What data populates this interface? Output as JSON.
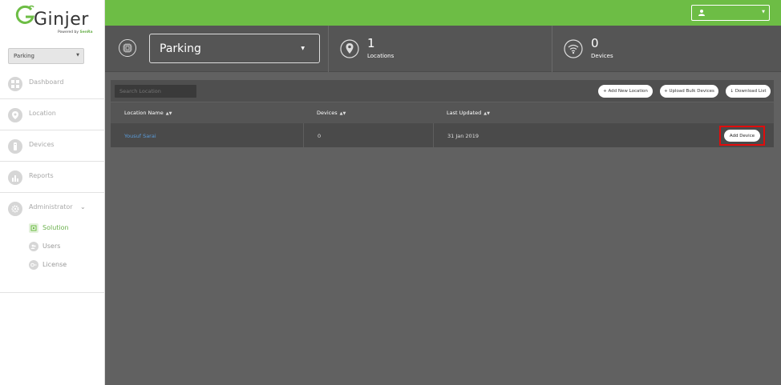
{
  "brand": {
    "name": "Ginjer",
    "powered_by": "Powered by",
    "partner": "SenRa"
  },
  "sidebar": {
    "solution_select": "Parking",
    "items": [
      {
        "label": "Dashboard",
        "icon": "dashboard-icon"
      },
      {
        "label": "Location",
        "icon": "location-pin-icon"
      },
      {
        "label": "Devices",
        "icon": "device-icon"
      },
      {
        "label": "Reports",
        "icon": "bar-chart-icon"
      },
      {
        "label": "Administrator",
        "icon": "gear-icon"
      }
    ],
    "sub_items": [
      {
        "label": "Solution",
        "icon": "chip-icon",
        "active": true
      },
      {
        "label": "Users",
        "icon": "users-icon",
        "active": false
      },
      {
        "label": "License",
        "icon": "key-icon",
        "active": false
      }
    ]
  },
  "header": {
    "user_icon": "user-icon"
  },
  "stats": {
    "solution": "Parking",
    "locations": {
      "count": "1",
      "label": "Locations"
    },
    "devices": {
      "count": "0",
      "label": "Devices"
    }
  },
  "toolbar": {
    "search_placeholder": "Search Location",
    "add_location": "+ Add New Location",
    "upload_bulk": "+ Upload Bulk Devices",
    "download": "↓ Download List"
  },
  "table": {
    "columns": [
      "Location Name",
      "Devices",
      "Last Updated"
    ],
    "rows": [
      {
        "location": "Yousuf Sarai",
        "devices": "0",
        "last_updated": "31 Jan 2019",
        "action": "Add Device"
      }
    ]
  },
  "colors": {
    "accent": "#6dbd45",
    "highlight": "#e10c0c",
    "link": "#5b9bd8"
  }
}
